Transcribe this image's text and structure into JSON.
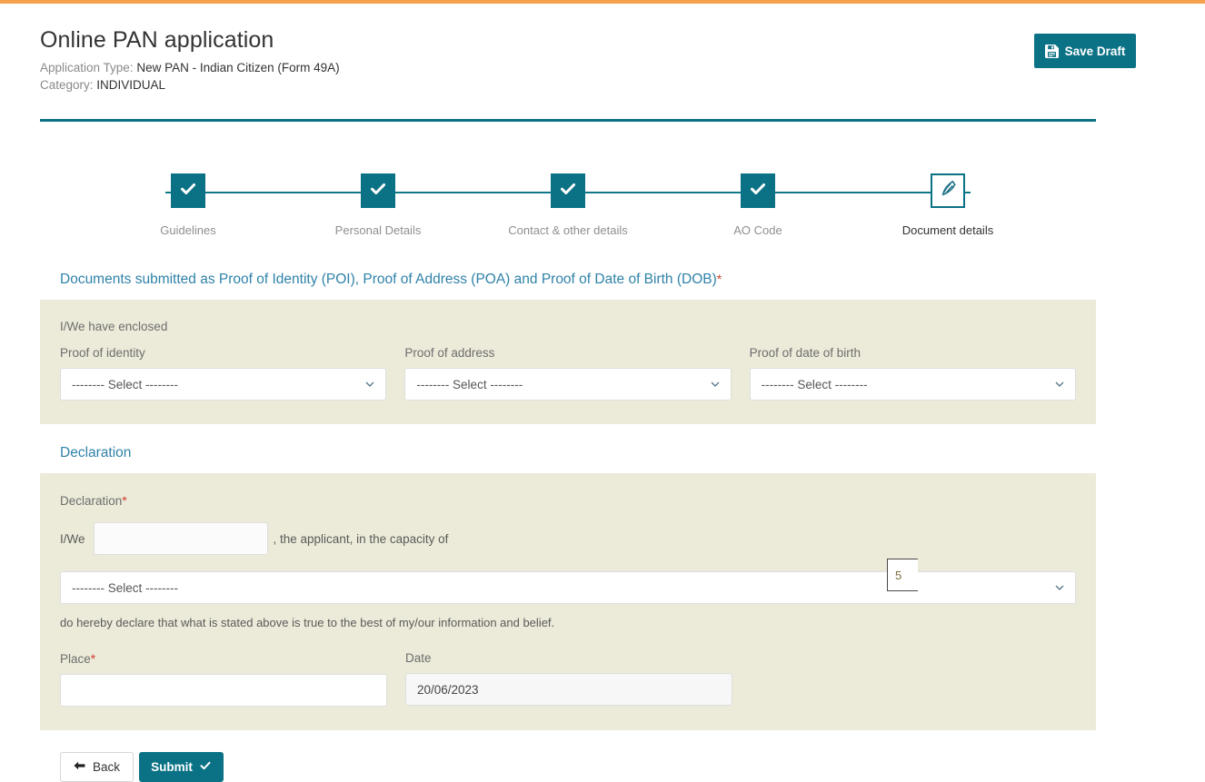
{
  "header": {
    "title": "Online PAN application",
    "application_type_label": "Application Type:",
    "application_type_value": "New PAN - Indian Citizen (Form 49A)",
    "category_label": "Category:",
    "category_value": "INDIVIDUAL",
    "save_draft_label": "Save Draft",
    "save_draft_icon": "floppy-disk-icon"
  },
  "accent_colors": {
    "top_bar": "#f5a04a",
    "teal": "#0b7285",
    "panel_beige": "#ecead8",
    "heading_blue": "#2f82a8",
    "required_red": "#d0402c"
  },
  "stepper": {
    "steps": [
      {
        "label": "Guidelines",
        "state": "done",
        "icon": "check-icon"
      },
      {
        "label": "Personal Details",
        "state": "done",
        "icon": "check-icon"
      },
      {
        "label": "Contact & other details",
        "state": "done",
        "icon": "check-icon"
      },
      {
        "label": "AO Code",
        "state": "done",
        "icon": "check-icon"
      },
      {
        "label": "Document details",
        "state": "current",
        "icon": "pen-nib-icon"
      }
    ]
  },
  "documents_section": {
    "heading": "Documents submitted as Proof of Identity (POI), Proof of Address (POA) and Proof of Date of Birth (DOB)",
    "heading_required": "*",
    "lead": "I/We have enclosed",
    "fields": [
      {
        "label": "Proof of identity",
        "value": "-------- Select --------"
      },
      {
        "label": "Proof of address",
        "value": "-------- Select --------"
      },
      {
        "label": "Proof of date of birth",
        "value": "-------- Select --------"
      }
    ]
  },
  "declaration_section": {
    "heading": "Declaration",
    "label": "Declaration",
    "label_required": "*",
    "lead_word": "I/We",
    "name_value": "",
    "tail_text": ", the applicant, in the capacity of",
    "capacity_value": "-------- Select --------",
    "overlay_badge": "5",
    "note": "do hereby declare that what is stated above is true to the best of my/our information and belief.",
    "place_label": "Place",
    "place_required": "*",
    "place_value": "",
    "date_label": "Date",
    "date_value": "20/06/2023"
  },
  "footer": {
    "back_label": "Back",
    "back_icon": "arrow-left-icon",
    "submit_label": "Submit",
    "submit_icon": "check-icon"
  }
}
